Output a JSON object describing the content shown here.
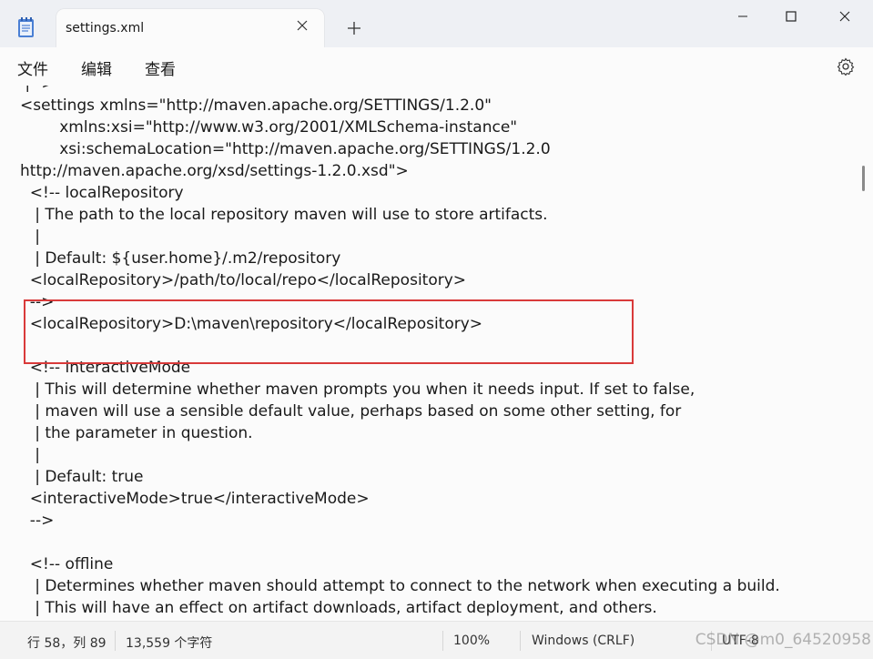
{
  "window": {
    "tab_title": "settings.xml",
    "tab_close_icon": "close-icon",
    "new_tab_icon": "plus-icon",
    "minimize_icon": "minimize-icon",
    "maximize_icon": "maximize-icon",
    "close_icon": "close-icon"
  },
  "menu": {
    "file": "文件",
    "edit": "编辑",
    "view": "查看",
    "settings_icon": "gear-icon"
  },
  "editor": {
    "lines": [
      " |-->",
      "<settings xmlns=\"http://maven.apache.org/SETTINGS/1.2.0\"",
      "        xmlns:xsi=\"http://www.w3.org/2001/XMLSchema-instance\"",
      "        xsi:schemaLocation=\"http://maven.apache.org/SETTINGS/1.2.0",
      "http://maven.apache.org/xsd/settings-1.2.0.xsd\">",
      "  <!-- localRepository",
      "   | The path to the local repository maven will use to store artifacts.",
      "   |",
      "   | Default: ${user.home}/.m2/repository",
      "  <localRepository>/path/to/local/repo</localRepository>",
      "  -->",
      "  <localRepository>D:\\maven\\repository</localRepository>",
      "",
      "  <!-- interactiveMode",
      "   | This will determine whether maven prompts you when it needs input. If set to false,",
      "   | maven will use a sensible default value, perhaps based on some other setting, for",
      "   | the parameter in question.",
      "   |",
      "   | Default: true",
      "  <interactiveMode>true</interactiveMode>",
      "  -->",
      "",
      "  <!-- offline",
      "   | Determines whether maven should attempt to connect to the network when executing a build.",
      "   | This will have an effect on artifact downloads, artifact deployment, and others."
    ]
  },
  "status": {
    "position": "行 58，列 89",
    "char_count": "13,559 个字符",
    "zoom": "100%",
    "line_ending": "Windows (CRLF)",
    "encoding": "UTF-8",
    "watermark": "CSDN @m0_64520958"
  },
  "colors": {
    "highlight_box": "#d93a3a",
    "editor_bg": "#fbfbfb",
    "titlebar_bg": "#eef0f4"
  }
}
